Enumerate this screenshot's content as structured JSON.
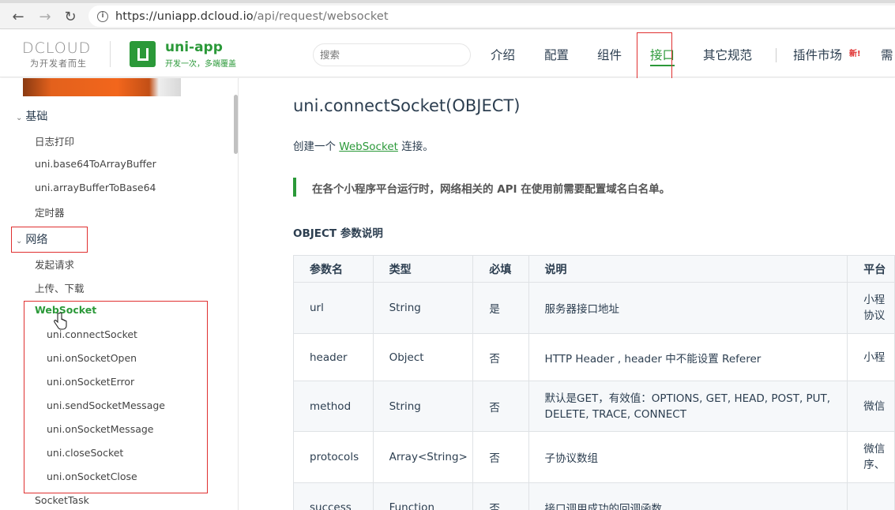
{
  "browser": {
    "url_host": "https://uniapp.dcloud.io",
    "url_path": "/api/request/websocket"
  },
  "header": {
    "dcloud_mark": "DCLOUD",
    "dcloud_slogan": "为开发者而生",
    "uni_name": "uni-app",
    "uni_slogan": "开发一次，多端覆盖",
    "search_placeholder": "搜索",
    "nav": [
      "介绍",
      "配置",
      "组件",
      "接口",
      "其它规范",
      "插件市场",
      "需"
    ],
    "new_badge": "新!",
    "active_nav": "接口"
  },
  "sidebar": {
    "section_basic": "基础",
    "basic_items": [
      "日志打印",
      "uni.base64ToArrayBuffer",
      "uni.arrayBufferToBase64",
      "定时器"
    ],
    "section_network": "网络",
    "network_items": [
      "发起请求",
      "上传、下载"
    ],
    "websocket_label": "WebSocket",
    "websocket_items": [
      "uni.connectSocket",
      "uni.onSocketOpen",
      "uni.onSocketError",
      "uni.sendSocketMessage",
      "uni.onSocketMessage",
      "uni.closeSocket",
      "uni.onSocketClose"
    ],
    "after_item": "SocketTask"
  },
  "content": {
    "title": "uni.connectSocket(OBJECT)",
    "desc_prefix": "创建一个",
    "desc_link": "WebSocket",
    "desc_suffix": "连接。",
    "tip": "在各个小程序平台运行时，网络相关的 API 在使用前需要配置域名白名单。",
    "section_title": "OBJECT 参数说明",
    "table": {
      "headers": [
        "参数名",
        "类型",
        "必填",
        "说明",
        "平台"
      ],
      "rows": [
        [
          "url",
          "String",
          "是",
          "服务器接口地址",
          "小程\n协议"
        ],
        [
          "header",
          "Object",
          "否",
          "HTTP Header , header 中不能设置 Referer",
          "小程"
        ],
        [
          "method",
          "String",
          "否",
          "默认是GET，有效值：OPTIONS, GET, HEAD, POST, PUT, DELETE, TRACE, CONNECT",
          "微信"
        ],
        [
          "protocols",
          "Array<String>",
          "否",
          "子协议数组",
          "微信\n序、"
        ],
        [
          "success",
          "Function",
          "否",
          "接口调用成功的回调函数",
          ""
        ]
      ]
    }
  },
  "colors": {
    "accent": "#2b9939",
    "highlight_box": "#e03030"
  }
}
